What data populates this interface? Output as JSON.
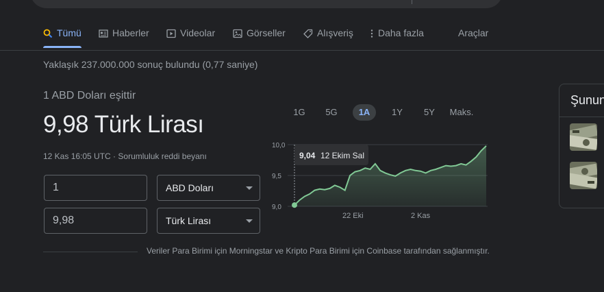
{
  "tabs": [
    {
      "label": "Tümü",
      "icon": "search-icon",
      "active": true
    },
    {
      "label": "Haberler",
      "icon": "news-icon"
    },
    {
      "label": "Videolar",
      "icon": "video-icon"
    },
    {
      "label": "Görseller",
      "icon": "image-icon"
    },
    {
      "label": "Alışveriş",
      "icon": "tag-icon"
    },
    {
      "label": "Daha fazla",
      "icon": "more-vert-icon"
    }
  ],
  "tools_label": "Araçlar",
  "stats": "Yaklaşık 237.000.000 sonuç bulundu (0,77 saniye)",
  "converter": {
    "equals_label": "1 ABD Doları eşittir",
    "result": "9,98 Türk Lirası",
    "timestamp": "12 Kas 16:05 UTC",
    "separator": " · ",
    "disclaimer": "Sorumluluk reddi beyanı",
    "from_amount": "1",
    "from_currency": "ABD Doları",
    "to_amount": "9,98",
    "to_currency": "Türk Lirası",
    "source_note": "Veriler Para Birimi için Morningstar ve Kripto Para Birimi için Coinbase tarafından sağlanmıştır."
  },
  "ranges": [
    "1G",
    "5G",
    "1A",
    "1Y",
    "5Y",
    "Maks."
  ],
  "active_range": "1A",
  "chart_data": {
    "type": "area",
    "x_tick_labels": [
      "22 Eki",
      "2 Kas"
    ],
    "y_tick_labels": [
      "10,0",
      "9,5",
      "9,0"
    ],
    "ylim": [
      9.0,
      10.0
    ],
    "values": [
      9.02,
      9.1,
      9.16,
      9.2,
      9.26,
      9.28,
      9.27,
      9.29,
      9.34,
      9.31,
      9.26,
      9.5,
      9.56,
      9.58,
      9.62,
      9.6,
      9.69,
      9.58,
      9.54,
      9.51,
      9.49,
      9.54,
      9.58,
      9.6,
      9.58,
      9.57,
      9.54,
      9.58,
      9.6,
      9.63,
      9.66,
      9.65,
      9.66,
      9.69,
      9.67,
      9.73,
      9.8,
      9.9,
      9.98
    ],
    "tooltip": {
      "value": "9,04",
      "date": "12 Ekim Sal"
    },
    "color": "#81c995"
  },
  "side_panel": {
    "title": "Şunun"
  }
}
